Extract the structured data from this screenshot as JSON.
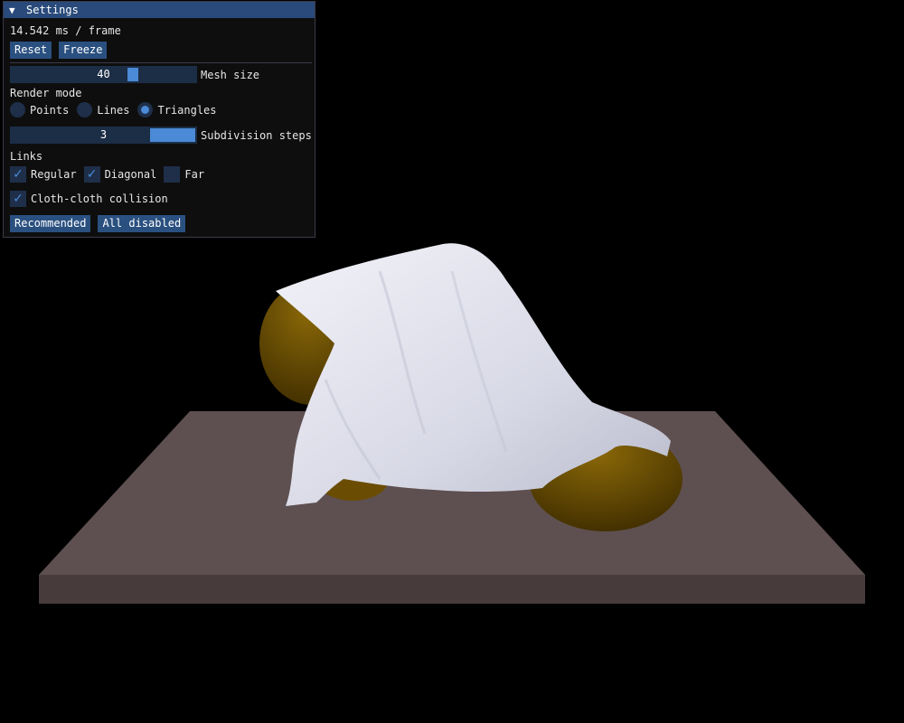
{
  "panel": {
    "title": "Settings",
    "collapse_icon": "triangle-down-icon",
    "frame_time": "14.542 ms / frame",
    "reset_label": "Reset",
    "freeze_label": "Freeze",
    "mesh_size": {
      "value": "40",
      "label": "Mesh size",
      "level": 0.68
    },
    "render_mode": {
      "heading": "Render mode",
      "options": [
        "Points",
        "Lines",
        "Triangles"
      ],
      "selected": "Triangles"
    },
    "subdivision": {
      "value": "3",
      "label": "Subdivision steps",
      "level": 1.0
    },
    "links": {
      "heading": "Links",
      "regular": {
        "label": "Regular",
        "checked": true
      },
      "diagonal": {
        "label": "Diagonal",
        "checked": true
      },
      "far": {
        "label": "Far",
        "checked": false
      }
    },
    "cloth_collision": {
      "label": "Cloth-cloth collision",
      "checked": true
    },
    "recommended_label": "Recommended",
    "all_disabled_label": "All disabled"
  },
  "scene": {
    "background": "#000000",
    "floor_color": "#5e4f50",
    "sphere_color": "#7a5a05",
    "cloth_color": "#dfe0ec"
  }
}
